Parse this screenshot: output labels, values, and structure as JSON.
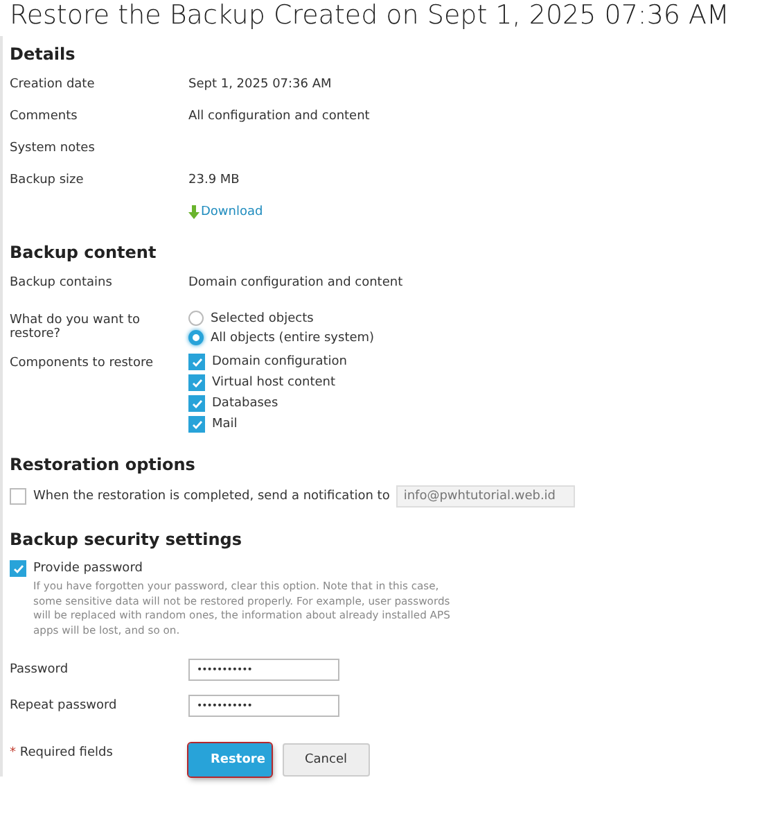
{
  "title": "Restore the Backup Created on Sept 1, 2025 07:36 AM",
  "details": {
    "heading": "Details",
    "rows": [
      {
        "label": "Creation date",
        "value": "Sept 1, 2025 07:36 AM"
      },
      {
        "label": "Comments",
        "value": "All configuration and content"
      },
      {
        "label": "System notes"
      },
      {
        "label": "Backup size",
        "value": "23.9 MB"
      }
    ],
    "download_link": "Download"
  },
  "backup_content": {
    "heading": "Backup content",
    "contains_label": "Backup contains",
    "contains_value": "Domain configuration and content",
    "restore_label": "What do you want to restore?",
    "restore_options": [
      {
        "label": "Selected objects",
        "selected": false
      },
      {
        "label": "All objects (entire system)",
        "selected": true
      }
    ],
    "components_label": "Components to restore",
    "components": [
      {
        "label": "Domain configuration",
        "checked": true
      },
      {
        "label": "Virtual host content",
        "checked": true
      },
      {
        "label": "Databases",
        "checked": true
      },
      {
        "label": "Mail",
        "checked": true
      }
    ]
  },
  "restoration_options": {
    "heading": "Restoration options",
    "notify": {
      "label": "When the restoration is completed, send a notification to",
      "checked": false,
      "email_placeholder": "info@pwhtutorial.web.id",
      "disabled": true
    }
  },
  "security": {
    "heading": "Backup security settings",
    "provide_password": {
      "label": "Provide password",
      "checked": true,
      "hint": "If you have forgotten your password, clear this option. Note that in this case, some sensitive data will not be restored properly. For example, user passwords will be replaced with random ones, the information about already installed APS apps will be lost, and so on."
    },
    "fields": [
      {
        "label": "Password",
        "value": "•••••••••••"
      },
      {
        "label": "Repeat password",
        "value": "•••••••••••"
      }
    ]
  },
  "footer": {
    "required_mark": "*",
    "required_text": "Required fields",
    "buttons": [
      {
        "label": "Restore",
        "kind": "primary",
        "focused": true
      },
      {
        "label": "Cancel",
        "kind": "secondary",
        "focused": false
      }
    ]
  }
}
